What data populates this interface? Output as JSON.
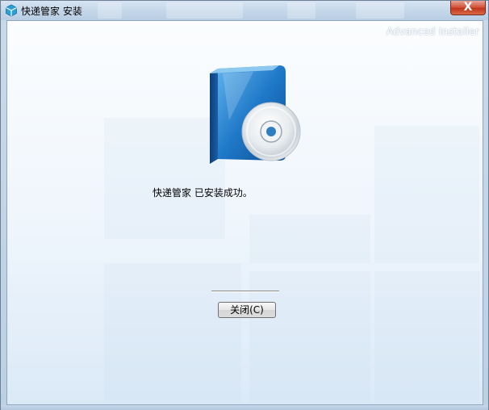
{
  "window": {
    "title": "快递管家 安装",
    "app_icon": "package-installer-icon",
    "close_label": "X"
  },
  "branding": {
    "text": "Advanced Installer"
  },
  "content": {
    "product_icon": "software-box-cd-icon",
    "message": "快递管家 已安装成功。"
  },
  "actions": {
    "close_button_label": "关闭(C)"
  },
  "colors": {
    "close_button": "#c1351b",
    "client_gradient_top": "#fbfdfe",
    "client_gradient_bottom": "#dbe9f7",
    "box_blue": "#1f6fb7"
  }
}
